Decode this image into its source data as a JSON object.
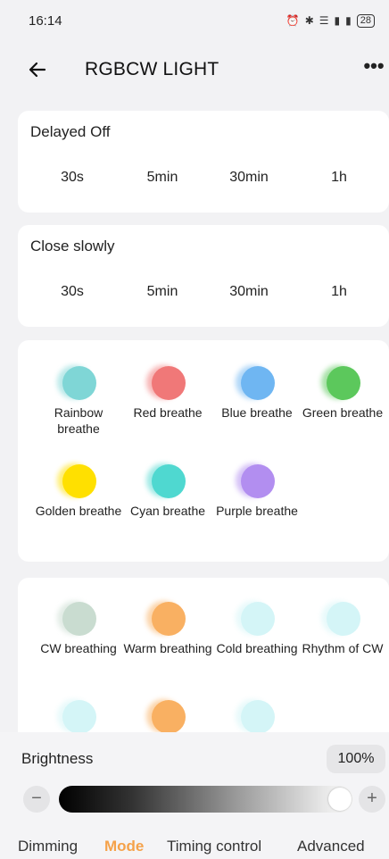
{
  "status_bar": {
    "time": "16:14",
    "icons": [
      "alarm-icon",
      "bluetooth-icon",
      "wifi-icon",
      "signal-icon",
      "signal-icon"
    ],
    "battery": "28"
  },
  "header": {
    "title": "RGBCW LIGHT",
    "more": "•••"
  },
  "delayed_off": {
    "title": "Delayed Off",
    "options": [
      "30s",
      "5min",
      "30min",
      "1h"
    ]
  },
  "close_slowly": {
    "title": "Close slowly",
    "options": [
      "30s",
      "5min",
      "30min",
      "1h"
    ]
  },
  "rgb_modes": [
    {
      "label": "Rainbow breathe",
      "color": "#7fd6d6"
    },
    {
      "label": "Red breathe",
      "color": "#f07878"
    },
    {
      "label": "Blue breathe",
      "color": "#6fb6f2"
    },
    {
      "label": "Green breathe",
      "color": "#5cc85c"
    },
    {
      "label": "Golden breathe",
      "color": "#ffe000"
    },
    {
      "label": "Cyan breathe",
      "color": "#4fd8d0"
    },
    {
      "label": "Purple breathe",
      "color": "#b28ef0"
    }
  ],
  "cw_modes": [
    {
      "label": "CW breathing",
      "color": "#c9dcd0"
    },
    {
      "label": "Warm breathing",
      "color": "#f9b062"
    },
    {
      "label": "Cold breathing",
      "color": "#d4f5f7"
    },
    {
      "label": "Rhythm of CW",
      "color": "#d4f5f7"
    },
    {
      "label": "",
      "color": "#d4f5f7"
    },
    {
      "label": "",
      "color": "#f9b062"
    },
    {
      "label": "",
      "color": "#d4f5f7"
    }
  ],
  "brightness": {
    "label": "Brightness",
    "value": "100%",
    "level": 1.0,
    "minus": "−",
    "plus": "+"
  },
  "tabs": [
    {
      "label": "Dimming",
      "active": false
    },
    {
      "label": "Mode",
      "active": true
    },
    {
      "label": "Timing control",
      "active": false
    },
    {
      "label": "Advanced",
      "active": false
    }
  ],
  "colors": {
    "accent": "#f5a24a",
    "card": "#ffffff",
    "background": "#f2f2f4"
  }
}
